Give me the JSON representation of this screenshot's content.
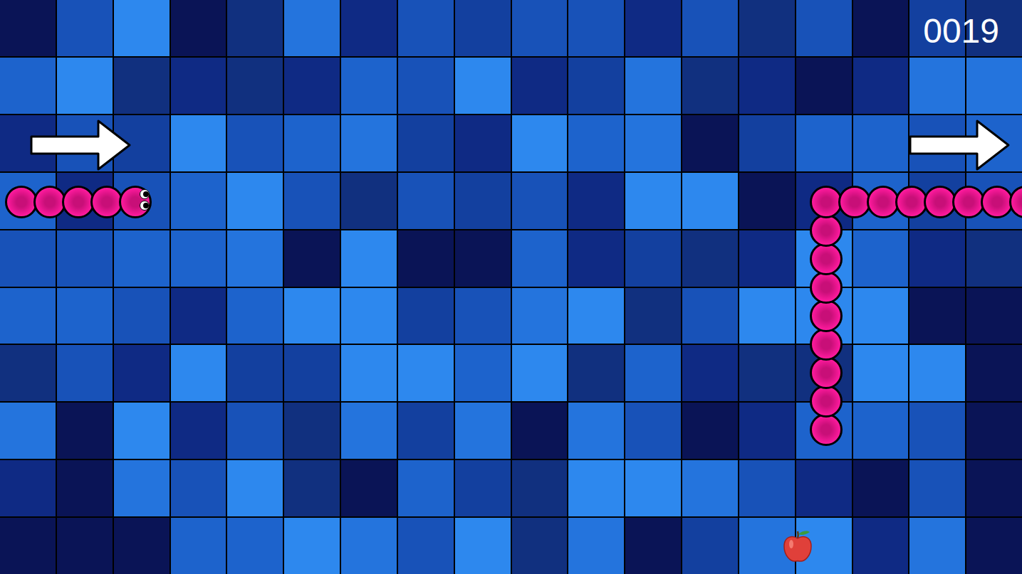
{
  "score": "0019",
  "wrap_arrows": [
    {
      "side": "left",
      "direction": "right"
    },
    {
      "side": "right",
      "direction": "right"
    }
  ],
  "snake": {
    "direction": "right",
    "segments": [
      [
        4.75,
        7.1
      ],
      [
        3.75,
        7.1
      ],
      [
        2.75,
        7.1
      ],
      [
        1.75,
        7.1
      ],
      [
        0.75,
        7.1
      ],
      [
        36,
        7.1
      ],
      [
        35,
        7.1
      ],
      [
        34,
        7.1
      ],
      [
        33,
        7.1
      ],
      [
        32,
        7.1
      ],
      [
        31,
        7.1
      ],
      [
        30,
        7.1
      ],
      [
        29,
        7.1
      ],
      [
        29,
        8.1
      ],
      [
        29,
        9.1
      ],
      [
        29,
        10.1
      ],
      [
        29,
        11.1
      ],
      [
        29,
        12.1
      ],
      [
        29,
        13.1
      ],
      [
        29,
        14.1
      ],
      [
        29,
        15.1
      ]
    ]
  },
  "apple": {
    "x": 28,
    "y": 19.2
  }
}
